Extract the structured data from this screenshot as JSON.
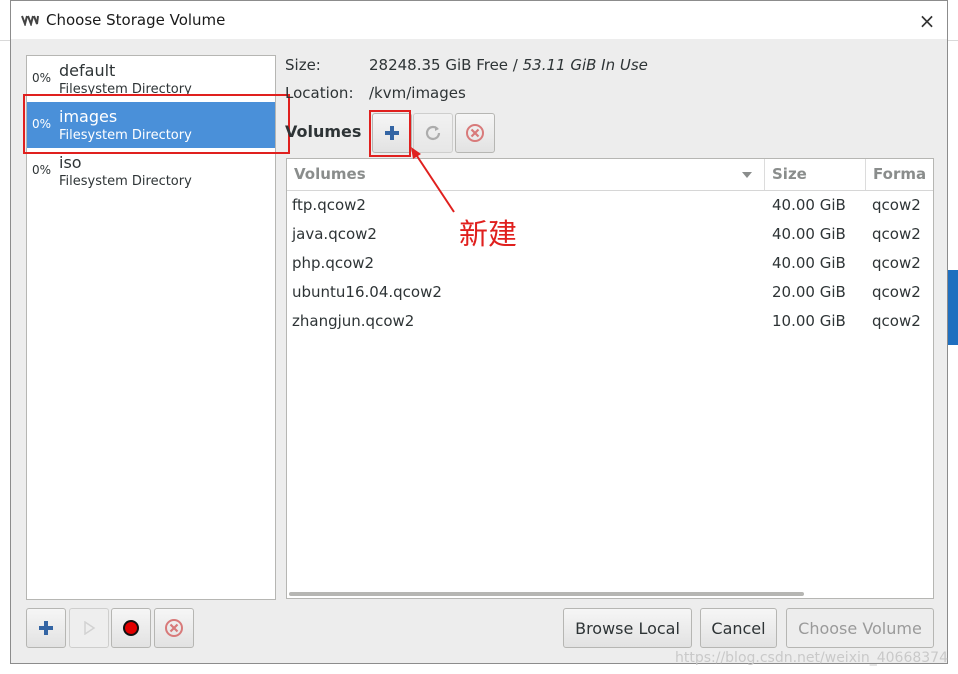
{
  "window": {
    "title": "Choose Storage Volume",
    "close_label": "×"
  },
  "pools": [
    {
      "percent": "0%",
      "name": "default",
      "type": "Filesystem Directory",
      "selected": false
    },
    {
      "percent": "0%",
      "name": "images",
      "type": "Filesystem Directory",
      "selected": true
    },
    {
      "percent": "0%",
      "name": "iso",
      "type": "Filesystem Directory",
      "selected": false
    }
  ],
  "details": {
    "size_label": "Size:",
    "size_free": "28248.35 GiB Free",
    "size_sep": " / ",
    "size_in_use": "53.11 GiB In Use",
    "location_label": "Location:",
    "location_value": "/kvm/images",
    "volumes_label": "Volumes"
  },
  "table": {
    "headers": [
      "Volumes",
      "Size",
      "Forma"
    ],
    "rows": [
      {
        "name": "ftp.qcow2",
        "size": "40.00 GiB",
        "format": "qcow2"
      },
      {
        "name": "java.qcow2",
        "size": "40.00 GiB",
        "format": "qcow2"
      },
      {
        "name": "php.qcow2",
        "size": "40.00 GiB",
        "format": "qcow2"
      },
      {
        "name": "ubuntu16.04.qcow2",
        "size": "20.00 GiB",
        "format": "qcow2"
      },
      {
        "name": "zhangjun.qcow2",
        "size": "10.00 GiB",
        "format": "qcow2"
      }
    ]
  },
  "annotation": {
    "text": "新建",
    "color": "#e0201e"
  },
  "buttons": {
    "browse_local": "Browse Local",
    "cancel": "Cancel",
    "choose_volume": "Choose Volume"
  },
  "watermark": "https://blog.csdn.net/weixin_40668374",
  "colors": {
    "selection": "#4a90d9",
    "accent_red": "#e0201e",
    "add_blue": "#3465a4"
  }
}
